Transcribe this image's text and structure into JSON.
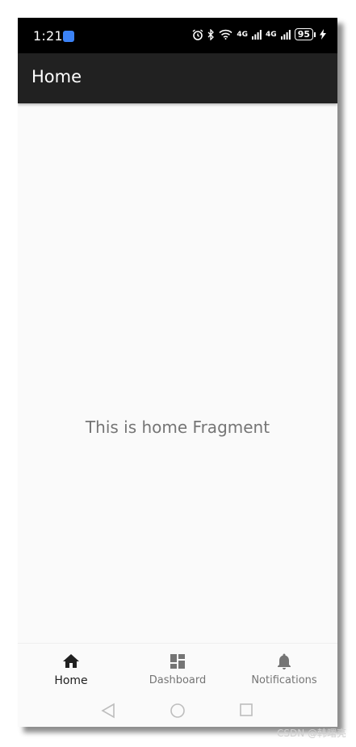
{
  "status_bar": {
    "time": "1:21",
    "network_label": "4G",
    "battery": "95"
  },
  "app_bar": {
    "title": "Home"
  },
  "content": {
    "text": "This is home Fragment"
  },
  "bottom_nav": {
    "items": [
      {
        "label": "Home",
        "icon": "home-icon",
        "active": true
      },
      {
        "label": "Dashboard",
        "icon": "dashboard-icon",
        "active": false
      },
      {
        "label": "Notifications",
        "icon": "bell-icon",
        "active": false
      }
    ]
  },
  "watermark": "CSDN @韩曙亮",
  "colors": {
    "app_bar": "#212121",
    "active_nav": "#212121",
    "inactive_nav": "#757575",
    "background": "#fafafa"
  }
}
